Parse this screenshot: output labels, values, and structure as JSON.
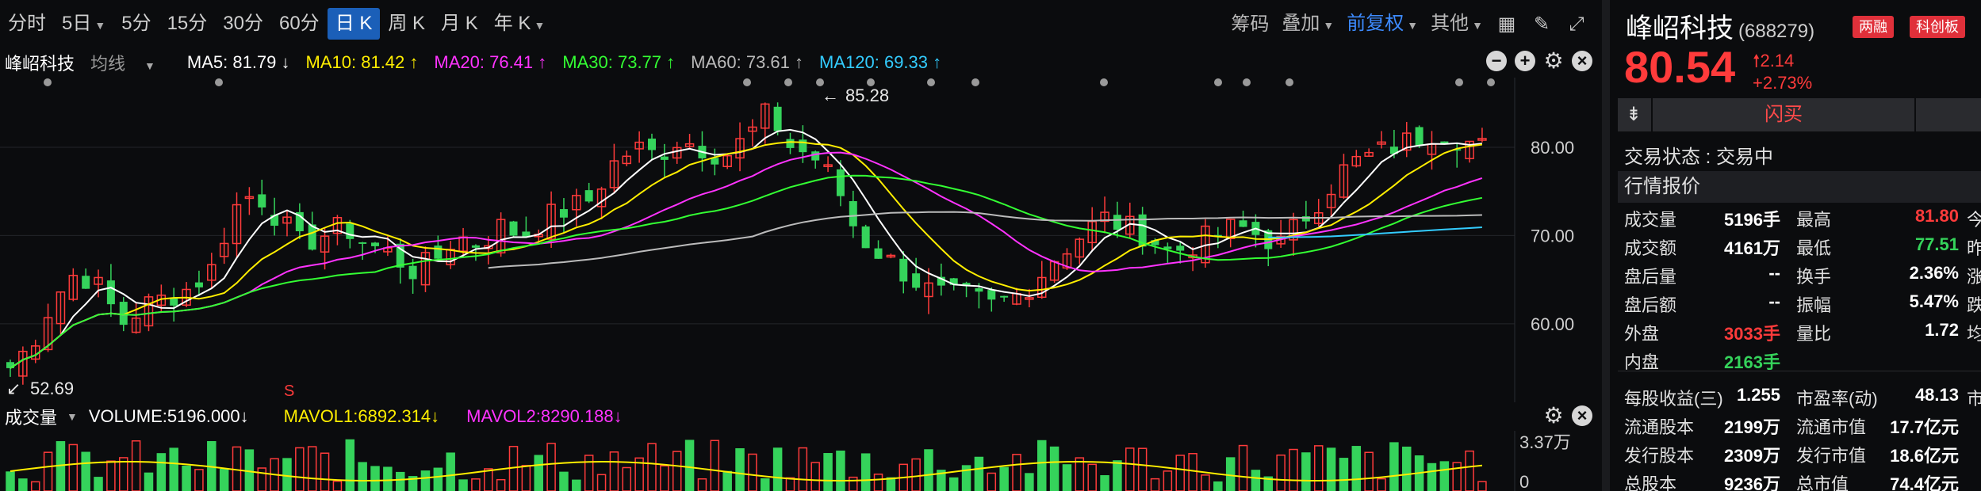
{
  "toolbar": {
    "items": [
      {
        "label": "分时",
        "caret": false,
        "active": false
      },
      {
        "label": "5日",
        "caret": true,
        "active": false
      },
      {
        "label": "5分",
        "caret": false,
        "active": false
      },
      {
        "label": "15分",
        "caret": false,
        "active": false
      },
      {
        "label": "30分",
        "caret": false,
        "active": false
      },
      {
        "label": "60分",
        "caret": false,
        "active": false
      },
      {
        "label": "日 K",
        "caret": false,
        "active": true
      },
      {
        "label": "周 K",
        "caret": false,
        "active": false
      },
      {
        "label": "月 K",
        "caret": false,
        "active": false
      },
      {
        "label": "年 K",
        "caret": true,
        "active": false
      }
    ],
    "right": {
      "chips": "筹码",
      "overlay": "叠加",
      "adjust": "前复权",
      "other": "其他"
    },
    "icons": [
      "grid-icon",
      "pen-icon",
      "fullscreen-icon"
    ]
  },
  "ma": {
    "name": "峰岹科技",
    "style": "均线",
    "ma5": "MA5: 81.79 ↓",
    "ma10": "MA10: 81.42 ↑",
    "ma20": "MA20: 76.41 ↑",
    "ma30": "MA30: 73.77 ↑",
    "ma60": "MA60: 73.61 ↑",
    "ma120": "MA120: 69.33 ↑"
  },
  "colors": {
    "up": "#ff3b3b",
    "down": "#35d35b",
    "ma5": "#ffffff",
    "ma10": "#ffee00",
    "ma20": "#ff33ff",
    "ma30": "#33ff33",
    "ma60": "#bbbbbb",
    "ma120": "#33ccff"
  },
  "chart_data": {
    "type": "candlestick",
    "y_ticks": [
      "80.00",
      "70.00",
      "60.00"
    ],
    "ylim": [
      52,
      87
    ],
    "high_label": "85.28",
    "low_label": "52.69",
    "marker_s": "S",
    "volume": {
      "title": "成交量",
      "volume": "VOLUME:5196.000↓",
      "mavol1": "MAVOL1:6892.314↓",
      "mavol2": "MAVOL2:8290.188↓",
      "y_ticks": [
        "3.37万",
        "0"
      ]
    }
  },
  "side": {
    "name": "峰岹科技",
    "code": "(688279)",
    "tag1": "两融",
    "tag2": "科创板",
    "price": "80.54",
    "change": "2.14",
    "change_pct": "+2.73%",
    "flash": "闪买",
    "status": "交易状态 : 交易中",
    "quote_title": "行情报价",
    "rows": [
      {
        "l1": "成交量",
        "v1": "5196手",
        "l2": "最高",
        "v2": "81.80",
        "c2": "red",
        "l3": "今"
      },
      {
        "l1": "成交额",
        "v1": "4161万",
        "l2": "最低",
        "v2": "77.51",
        "c2": "green",
        "l3": "昨"
      },
      {
        "l1": "盘后量",
        "v1": "--",
        "l2": "换手",
        "v2": "2.36%",
        "l3": "涨"
      },
      {
        "l1": "盘后额",
        "v1": "--",
        "l2": "振幅",
        "v2": "5.47%",
        "l3": "跌"
      },
      {
        "l1": "外盘",
        "v1": "3033手",
        "c1": "red",
        "l2": "量比",
        "v2": "1.72",
        "l3": "均"
      },
      {
        "l1": "内盘",
        "v1": "2163手",
        "c1": "green",
        "l2": "",
        "v2": "",
        "l3": ""
      },
      {
        "l1": "每股收益(三)",
        "v1": "1.255",
        "l2": "市盈率(动)",
        "v2": "48.13",
        "l3": "市"
      },
      {
        "l1": "流通股本",
        "v1": "2199万",
        "l2": "流通市值",
        "v2": "17.7亿元",
        "l3": ""
      },
      {
        "l1": "发行股本",
        "v1": "2309万",
        "l2": "发行市值",
        "v2": "18.6亿元",
        "l3": ""
      },
      {
        "l1": "总股本",
        "v1": "9236万",
        "l2": "总市值",
        "v2": "74.4亿元",
        "l3": ""
      }
    ]
  }
}
